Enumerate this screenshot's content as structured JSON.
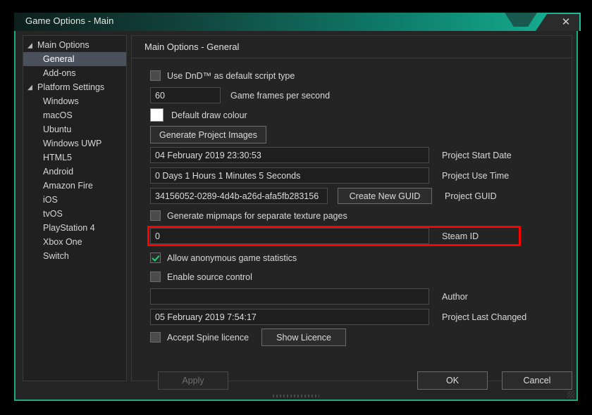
{
  "window": {
    "title": "Game Options - Main",
    "close_icon": "close-icon",
    "accent_color": "#1fa97f",
    "highlight_color": "#ff0000"
  },
  "sidebar": {
    "collapse_icon": "«",
    "items": [
      {
        "label": "Main Options",
        "level": "root",
        "expanded": true,
        "selected": false,
        "arrow": "◢"
      },
      {
        "label": "General",
        "level": "child",
        "expanded": false,
        "selected": true,
        "arrow": ""
      },
      {
        "label": "Add-ons",
        "level": "child",
        "expanded": false,
        "selected": false,
        "arrow": ""
      },
      {
        "label": "Platform Settings",
        "level": "root",
        "expanded": true,
        "selected": false,
        "arrow": "◢"
      },
      {
        "label": "Windows",
        "level": "child",
        "expanded": false,
        "selected": false,
        "arrow": ""
      },
      {
        "label": "macOS",
        "level": "child",
        "expanded": false,
        "selected": false,
        "arrow": ""
      },
      {
        "label": "Ubuntu",
        "level": "child",
        "expanded": false,
        "selected": false,
        "arrow": ""
      },
      {
        "label": "Windows UWP",
        "level": "child",
        "expanded": false,
        "selected": false,
        "arrow": ""
      },
      {
        "label": "HTML5",
        "level": "child",
        "expanded": false,
        "selected": false,
        "arrow": ""
      },
      {
        "label": "Android",
        "level": "child",
        "expanded": false,
        "selected": false,
        "arrow": ""
      },
      {
        "label": "Amazon Fire",
        "level": "child",
        "expanded": false,
        "selected": false,
        "arrow": ""
      },
      {
        "label": "iOS",
        "level": "child",
        "expanded": false,
        "selected": false,
        "arrow": ""
      },
      {
        "label": "tvOS",
        "level": "child",
        "expanded": false,
        "selected": false,
        "arrow": ""
      },
      {
        "label": "PlayStation 4",
        "level": "child",
        "expanded": false,
        "selected": false,
        "arrow": ""
      },
      {
        "label": "Xbox One",
        "level": "child",
        "expanded": false,
        "selected": false,
        "arrow": ""
      },
      {
        "label": "Switch",
        "level": "child",
        "expanded": false,
        "selected": false,
        "arrow": ""
      }
    ]
  },
  "content": {
    "header": "Main Options - General",
    "dnd_checkbox_label": "Use DnD™ as default script type",
    "fps_value": "60",
    "fps_label": "Game frames per second",
    "draw_colour_label": "Default draw colour",
    "draw_colour_swatch": "#ffffff",
    "generate_images_button": "Generate Project Images",
    "start_date_value": "04 February 2019 23:30:53",
    "start_date_label": "Project Start Date",
    "use_time_value": "0 Days 1 Hours 1 Minutes 5 Seconds",
    "use_time_label": "Project Use Time",
    "guid_value": "34156052-0289-4d4b-a26d-afa5fb283156",
    "guid_button": "Create New GUID",
    "guid_label": "Project GUID",
    "mipmaps_label": "Generate mipmaps for separate texture pages",
    "steam_id_value": "0",
    "steam_id_label": "Steam ID",
    "anon_stats_label": "Allow anonymous game statistics",
    "source_control_label": "Enable source control",
    "author_value": "",
    "author_placeholder": "",
    "author_label": "Author",
    "last_changed_value": "05 February 2019 7:54:17",
    "last_changed_label": "Project Last Changed",
    "spine_licence_label": "Accept Spine licence",
    "show_licence_button": "Show Licence"
  },
  "footer": {
    "apply_label": "Apply",
    "ok_label": "OK",
    "cancel_label": "Cancel"
  }
}
